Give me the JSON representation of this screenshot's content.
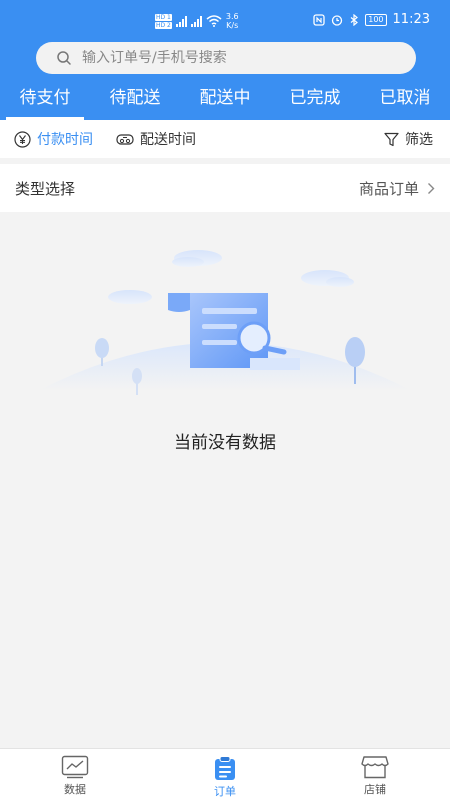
{
  "status_bar": {
    "speed": "3.6",
    "speed_unit": "K/s",
    "battery": "100",
    "time": "11:23",
    "hd1": "HD 1",
    "hd2": "HD 2"
  },
  "search": {
    "placeholder": "输入订单号/手机号搜索"
  },
  "tabs": [
    {
      "label": "待支付",
      "active": true
    },
    {
      "label": "待配送"
    },
    {
      "label": "配送中"
    },
    {
      "label": "已完成"
    },
    {
      "label": "已取消"
    }
  ],
  "filters": {
    "pay_time": "付款时间",
    "delivery_time": "配送时间",
    "filter": "筛选"
  },
  "type_row": {
    "label": "类型选择",
    "value": "商品订单"
  },
  "empty_text": "当前没有数据",
  "bottom_nav": [
    {
      "label": "数据"
    },
    {
      "label": "订单",
      "active": true
    },
    {
      "label": "店铺"
    }
  ],
  "colors": {
    "primary": "#3a8ff2",
    "background": "#f3f3f3"
  }
}
